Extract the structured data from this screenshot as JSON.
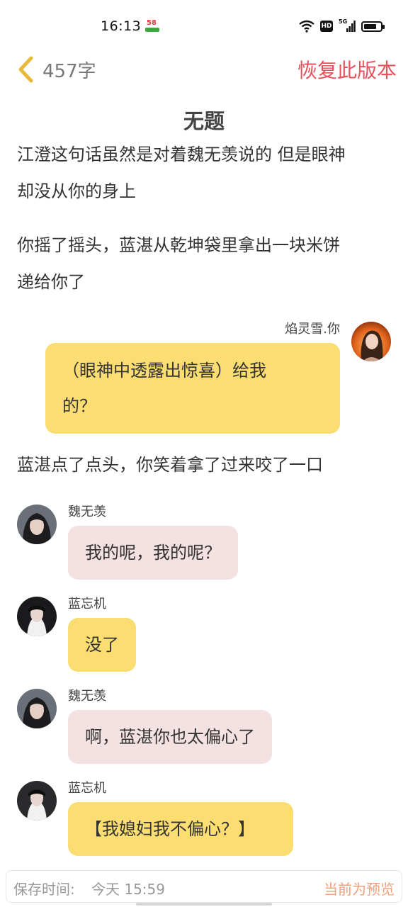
{
  "status_bar": {
    "time": "16:13",
    "app_badge": "58",
    "hd": "HD",
    "network": "5G",
    "battery_level": 0.75
  },
  "header": {
    "word_count": "457字",
    "restore_label": "恢复此版本",
    "accent_color": "#e8505b"
  },
  "story": {
    "title": "无题",
    "paragraphs": [
      {
        "lines": [
          "江澄这句话虽然是对着魏无羡说的 但是眼神",
          "却没从你的身上"
        ]
      },
      {
        "lines": [
          "你摇了摇头，蓝湛从乾坤袋里拿出一块米饼",
          "递给你了"
        ]
      },
      {
        "lines": [
          "蓝湛点了点头，你笑着拿了过来咬了一口"
        ]
      }
    ],
    "messages": [
      {
        "speaker": "焰灵雪.你",
        "side": "right",
        "bubble_color": "#fcdd72",
        "lines": [
          "（眼神中透露出惊喜）给我",
          "的？"
        ]
      },
      {
        "speaker": "魏无羡",
        "side": "left",
        "bubble_color": "#f4e1e2",
        "text": "我的呢，我的呢？"
      },
      {
        "speaker": "蓝忘机",
        "side": "left",
        "bubble_color": "#fcdd72",
        "text": "没了"
      },
      {
        "speaker": "魏无羡",
        "side": "left",
        "bubble_color": "#f4e1e2",
        "text": "啊，蓝湛你也太偏心了"
      },
      {
        "speaker": "蓝忘机",
        "side": "left",
        "bubble_color": "#fcdd72",
        "text": "【我媳妇我不偏心？】"
      }
    ]
  },
  "footer": {
    "save_label": "保存时间:",
    "save_time": "今天 15:59",
    "preview_label": "当前为预览"
  }
}
